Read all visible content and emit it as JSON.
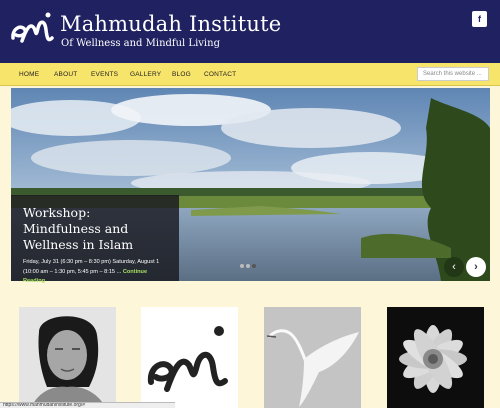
{
  "header": {
    "title": "Mahmudah Institute",
    "tagline": "Of Wellness and Mindful Living",
    "facebook_label": "f"
  },
  "nav": {
    "items": [
      "HOME",
      "ABOUT",
      "EVENTS",
      "GALLERY",
      "BLOG",
      "CONTACT"
    ],
    "search_placeholder": "Search this website ..."
  },
  "slider": {
    "title": "Workshop: Mindfulness and Wellness in Islam",
    "text": "Friday, July 31 (6:30 pm – 8:30 pm) Saturday, August 1 (10:00 am – 1:30 pm, 5:45 pm – 8:15 ... ",
    "link_label": "Continue Reading",
    "prev_label": "‹",
    "next_label": "›",
    "slide_count": 3,
    "active_slide": 3
  },
  "cards": [
    {
      "icon": "portrait-photo"
    },
    {
      "icon": "logo-mark"
    },
    {
      "icon": "egret-photo"
    },
    {
      "icon": "flower-photo"
    }
  ],
  "status_bar": {
    "url": "https://www.mahmudahinstitute.org/#"
  },
  "colors": {
    "header_bg": "#1f2160",
    "nav_bg": "#f7e46a",
    "page_bg": "#fdf6d8",
    "link_green": "#a8e063"
  }
}
